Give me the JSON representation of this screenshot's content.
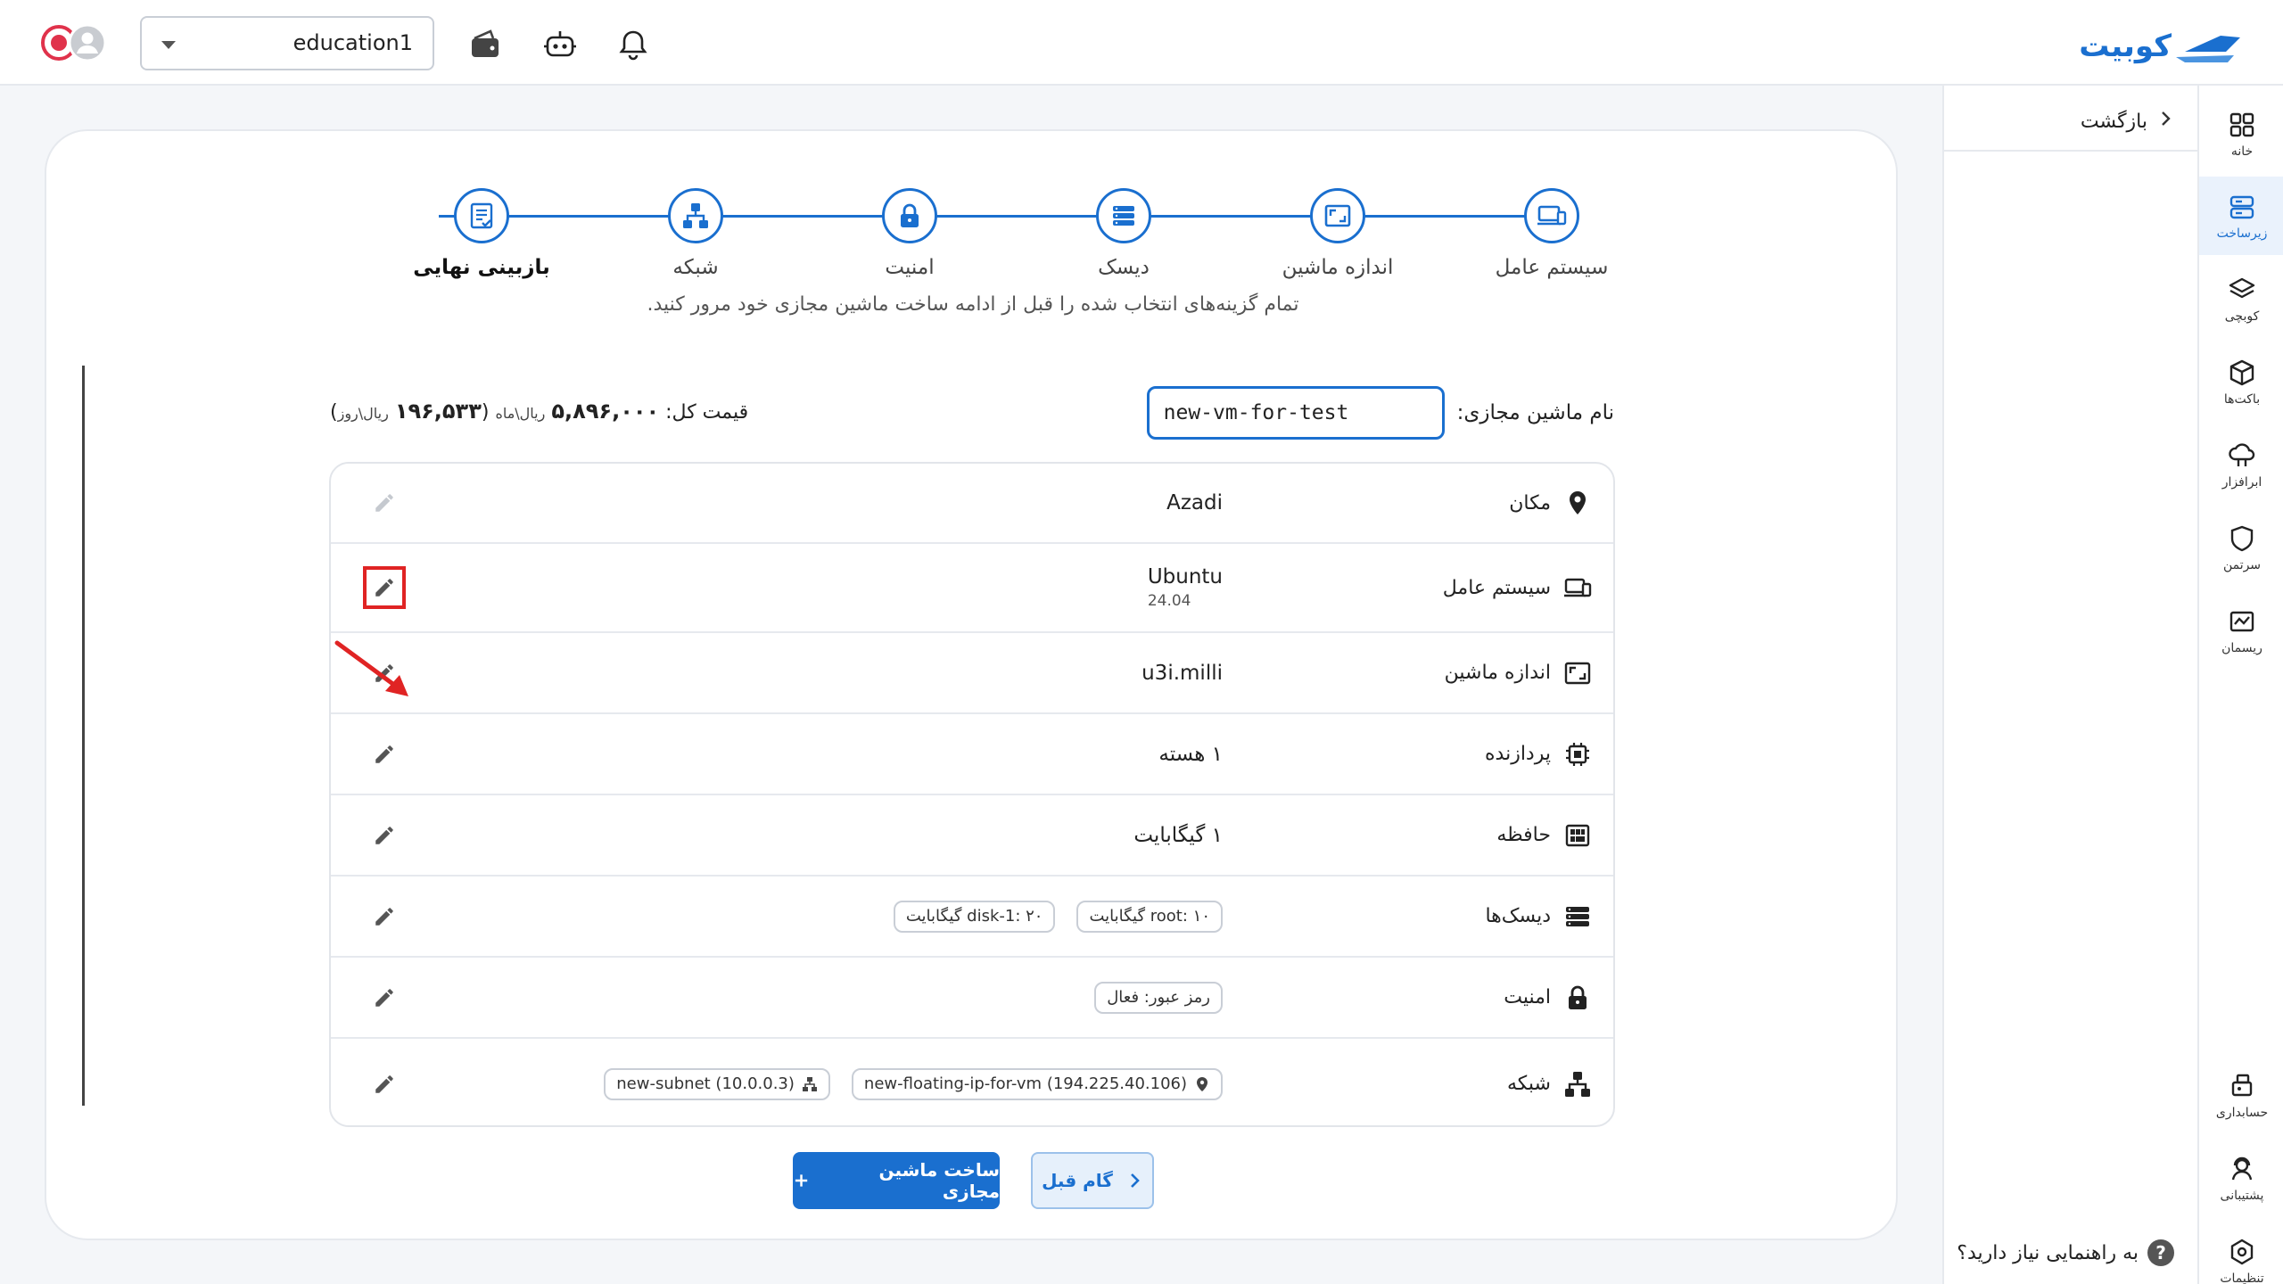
{
  "header": {
    "brand": "کوبیت",
    "project": "education1",
    "icons": [
      "bell-icon",
      "robot-icon",
      "wallet-icon",
      "avatar-icon",
      "avatar-icon"
    ]
  },
  "nav": {
    "items": [
      {
        "label": "خانه",
        "icon": "grid-icon"
      },
      {
        "label": "زیرساخت",
        "icon": "server-icon",
        "active": true
      },
      {
        "label": "کوبچی",
        "icon": "layers-icon"
      },
      {
        "label": "باکت‌ها",
        "icon": "cube-icon"
      },
      {
        "label": "ابرافزار",
        "icon": "cloud-app-icon"
      },
      {
        "label": "سرتمن",
        "icon": "shield-icon"
      },
      {
        "label": "ریسمان",
        "icon": "chart-box-icon"
      },
      {
        "label": "حسابداری",
        "icon": "accounting-icon"
      },
      {
        "label": "پشتیبانی",
        "icon": "support-icon"
      },
      {
        "label": "تنظیمات",
        "icon": "settings-icon"
      }
    ]
  },
  "back_panel": {
    "back_label": "بازگشت",
    "help_label": "به راهنمایی نیاز دارید؟",
    "help_glyph": "?"
  },
  "stepper": {
    "steps": [
      {
        "label": "سیستم عامل",
        "icon": "laptop-icon"
      },
      {
        "label": "اندازه ماشین",
        "icon": "resize-icon"
      },
      {
        "label": "دیسک",
        "icon": "disk-stack-icon"
      },
      {
        "label": "امنیت",
        "icon": "lock-icon"
      },
      {
        "label": "شبکه",
        "icon": "network-icon"
      },
      {
        "label": "بازبینی نهایی",
        "icon": "checklist-icon",
        "current": true
      }
    ]
  },
  "subtitle": "تمام گزینه‌های انتخاب شده را قبل از ادامه ساخت ماشین مجازی خود مرور کنید.",
  "vm_name": {
    "label": "نام ماشین مجازی:",
    "value": "new-vm-for-test"
  },
  "price": {
    "label": "قیمت کل:",
    "monthly": "۵,۸۹۶,۰۰۰",
    "monthly_unit": "ریال\\ماه",
    "daily": "۱۹۶,۵۳۳",
    "daily_unit": "ریال\\روز"
  },
  "summary": {
    "rows": [
      {
        "label": "مکان",
        "icon": "location-pin-icon",
        "value": "Azadi",
        "edit_enabled": false
      },
      {
        "label": "سیستم عامل",
        "icon": "laptop-icon",
        "value": "Ubuntu",
        "sub": "24.04",
        "edit_enabled": true,
        "highlighted": true
      },
      {
        "label": "اندازه ماشین",
        "icon": "resize-icon",
        "value": "u3i.milli",
        "edit_enabled": true
      },
      {
        "label": "پردازنده",
        "icon": "cpu-icon",
        "value": "۱ هسته",
        "edit_enabled": true
      },
      {
        "label": "حافظه",
        "icon": "memory-icon",
        "value": "۱ گیگابایت",
        "edit_enabled": true
      },
      {
        "label": "دیسک‌ها",
        "icon": "disk-stack-icon",
        "chips": [
          "root: ۱۰ گیگابایت",
          "disk-1: ۲۰ گیگابایت"
        ],
        "edit_enabled": true
      },
      {
        "label": "امنیت",
        "icon": "lock-icon",
        "chips": [
          "رمز عبور: فعال"
        ],
        "edit_enabled": true
      },
      {
        "label": "شبکه",
        "icon": "network-icon",
        "chips": [
          "new-floating-ip-for-vm (194.225.40.106)",
          "new-subnet (10.0.0.3)"
        ],
        "edit_enabled": true
      }
    ]
  },
  "actions": {
    "create_label": "ساخت ماشین مجازی",
    "prev_label": "گام قبل"
  },
  "colors": {
    "accent": "#1a6fcf",
    "highlight": "#e02424"
  }
}
